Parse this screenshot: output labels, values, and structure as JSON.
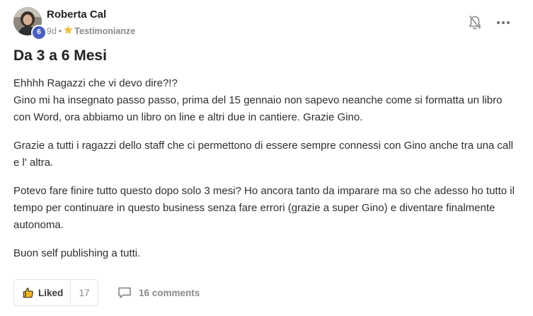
{
  "author": {
    "name": "Roberta Cal",
    "level": "6",
    "avatar_icon": "user-photo"
  },
  "meta": {
    "age": "9d",
    "separator": "•",
    "category_icon": "star-icon",
    "category": "Testimonianze"
  },
  "post": {
    "title": "Da 3 a 6 Mesi",
    "paragraphs": [
      "Ehhhh Ragazzi che vi devo dire?!?",
      "Gino mi ha insegnato passo passo, prima del 15 gennaio non sapevo neanche come si formatta un libro con Word, ora abbiamo un libro on line e altri due in cantiere. Grazie Gino.",
      "Grazie a tutti i ragazzi dello staff che ci permettono di essere sempre connessi con Gino anche tra una call e l' altra.",
      "Potevo fare finire tutto questo dopo solo 3 mesi? Ho ancora tanto da imparare ma so che adesso ho tutto il tempo per continuare in questo business senza fare errori (grazie a super Gino) e diventare finalmente autonoma.",
      "Buon self publishing a tutti."
    ]
  },
  "actions": {
    "like_label": "Liked",
    "like_count": "17",
    "comments_label": "16 comments"
  },
  "colors": {
    "badge": "#4a5fc1",
    "like_thumb": "#f5b71c",
    "muted_text": "#8a8a8a"
  }
}
